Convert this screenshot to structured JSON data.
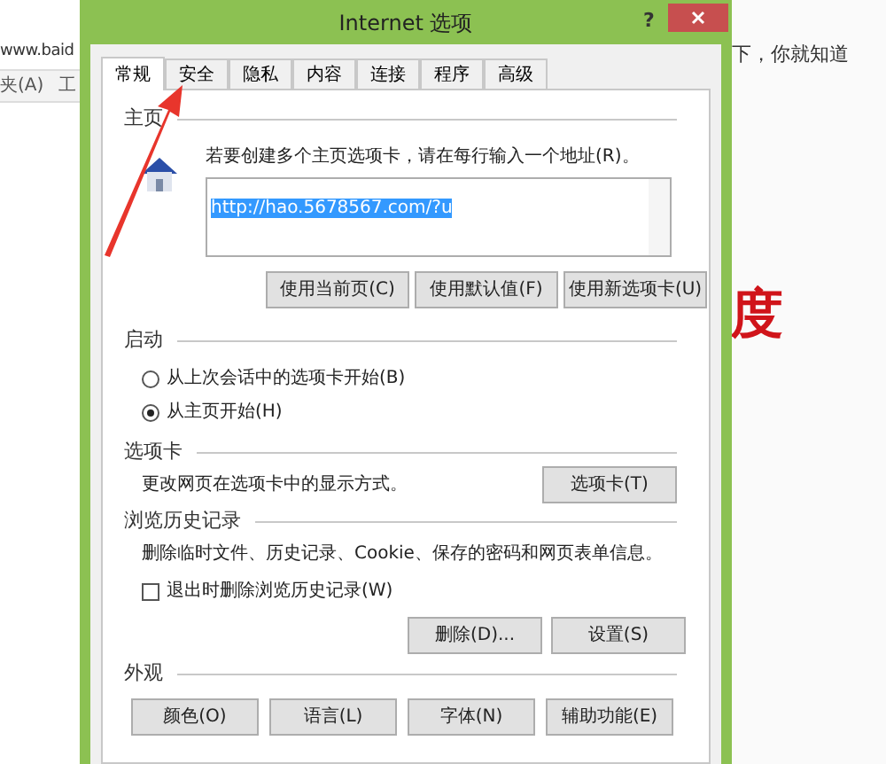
{
  "browser": {
    "address_fragment": "www.baid",
    "menu_fragment_1": "夹(A)",
    "menu_fragment_2": "工",
    "page_text": "下，你就知道",
    "logo_fragment": "度"
  },
  "window": {
    "title": "Internet 选项",
    "help": "?"
  },
  "tabs": [
    {
      "label": "常规",
      "selected": true
    },
    {
      "label": "安全",
      "selected": false
    },
    {
      "label": "隐私",
      "selected": false
    },
    {
      "label": "内容",
      "selected": false
    },
    {
      "label": "连接",
      "selected": false
    },
    {
      "label": "程序",
      "selected": false
    },
    {
      "label": "高级",
      "selected": false
    }
  ],
  "home_page": {
    "heading": "主页",
    "hint": "若要创建多个主页选项卡，请在每行输入一个地址(R)。",
    "value": "http://hao.5678567.com/?u",
    "value_selected": true,
    "buttons": [
      "使用当前页(C)",
      "使用默认值(F)",
      "使用新选项卡(U)"
    ]
  },
  "startup": {
    "heading": "启动",
    "options": [
      {
        "label": "从上次会话中的选项卡开始(B)",
        "selected": false
      },
      {
        "label": "从主页开始(H)",
        "selected": true
      }
    ]
  },
  "tabs_section": {
    "heading": "选项卡",
    "description": "更改网页在选项卡中的显示方式。",
    "button": "选项卡(T)"
  },
  "history": {
    "heading": "浏览历史记录",
    "description": "删除临时文件、历史记录、Cookie、保存的密码和网页表单信息。",
    "delete_on_exit": {
      "label": "退出时删除浏览历史记录(W)",
      "checked": false
    },
    "buttons": [
      "删除(D)...",
      "设置(S)"
    ]
  },
  "appearance": {
    "heading": "外观",
    "buttons": [
      "颜色(O)",
      "语言(L)",
      "字体(N)",
      "辅助功能(E)"
    ]
  }
}
